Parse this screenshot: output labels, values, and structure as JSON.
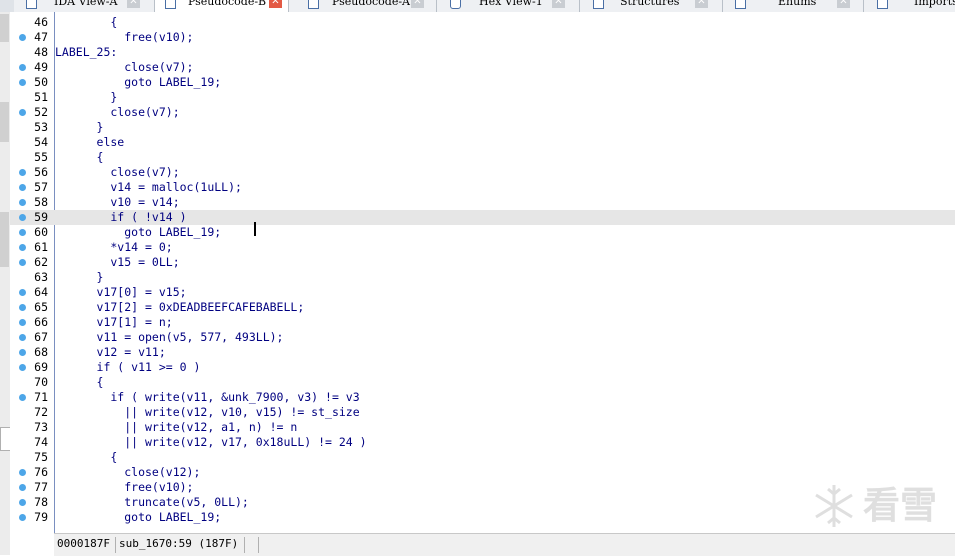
{
  "tabs": [
    {
      "label": "IDA View-A",
      "active": false
    },
    {
      "label": "Pseudocode-B",
      "active": true
    },
    {
      "label": "Pseudocode-A",
      "active": false
    },
    {
      "label": "Hex View-1",
      "active": false
    },
    {
      "label": "Structures",
      "active": false
    },
    {
      "label": "Enums",
      "active": false
    },
    {
      "label": "Imports",
      "active": false
    }
  ],
  "code_lines": [
    {
      "num": "46",
      "text": "        {",
      "dot": false
    },
    {
      "num": "47",
      "text": "          free(v10);",
      "dot": true
    },
    {
      "num": "48",
      "text": "LABEL_25:",
      "dot": false
    },
    {
      "num": "49",
      "text": "          close(v7);",
      "dot": true
    },
    {
      "num": "50",
      "text": "          goto LABEL_19;",
      "dot": true
    },
    {
      "num": "51",
      "text": "        }",
      "dot": false
    },
    {
      "num": "52",
      "text": "        close(v7);",
      "dot": true
    },
    {
      "num": "53",
      "text": "      }",
      "dot": false
    },
    {
      "num": "54",
      "text": "      else",
      "dot": false
    },
    {
      "num": "55",
      "text": "      {",
      "dot": false
    },
    {
      "num": "56",
      "text": "        close(v7);",
      "dot": true
    },
    {
      "num": "57",
      "text": "        v14 = malloc(1uLL);",
      "dot": true
    },
    {
      "num": "58",
      "text": "        v10 = v14;",
      "dot": true
    },
    {
      "num": "59",
      "text": "        if ( !v14 )",
      "dot": true
    },
    {
      "num": "60",
      "text": "          goto LABEL_19;",
      "dot": true
    },
    {
      "num": "61",
      "text": "        *v14 = 0;",
      "dot": true
    },
    {
      "num": "62",
      "text": "        v15 = 0LL;",
      "dot": true
    },
    {
      "num": "63",
      "text": "      }",
      "dot": false
    },
    {
      "num": "64",
      "text": "      v17[0] = v15;",
      "dot": true
    },
    {
      "num": "65",
      "text": "      v17[2] = 0xDEADBEEFCAFEBABELL;",
      "dot": true
    },
    {
      "num": "66",
      "text": "      v17[1] = n;",
      "dot": true
    },
    {
      "num": "67",
      "text": "      v11 = open(v5, 577, 493LL);",
      "dot": true
    },
    {
      "num": "68",
      "text": "      v12 = v11;",
      "dot": true
    },
    {
      "num": "69",
      "text": "      if ( v11 >= 0 )",
      "dot": true
    },
    {
      "num": "70",
      "text": "      {",
      "dot": false
    },
    {
      "num": "71",
      "text": "        if ( write(v11, &unk_7900, v3) != v3",
      "dot": true
    },
    {
      "num": "72",
      "text": "          || write(v12, v10, v15) != st_size",
      "dot": false
    },
    {
      "num": "73",
      "text": "          || write(v12, a1, n) != n",
      "dot": false
    },
    {
      "num": "74",
      "text": "          || write(v12, v17, 0x18uLL) != 24 )",
      "dot": false
    },
    {
      "num": "75",
      "text": "        {",
      "dot": false
    },
    {
      "num": "76",
      "text": "          close(v12);",
      "dot": true
    },
    {
      "num": "77",
      "text": "          free(v10);",
      "dot": true
    },
    {
      "num": "78",
      "text": "          truncate(v5, 0LL);",
      "dot": true
    },
    {
      "num": "79",
      "text": "          goto LABEL_19;",
      "dot": true
    }
  ],
  "highlighted_line": "59",
  "status": {
    "address": "0000187F",
    "location": "sub_1670:59 (187F)"
  },
  "watermark": "看雪",
  "colors": {
    "code": "#000080",
    "variable": "#6666cc",
    "dot": "#4da6e8",
    "highlight": "#e6e6e6",
    "active_close": "#e35a45"
  }
}
